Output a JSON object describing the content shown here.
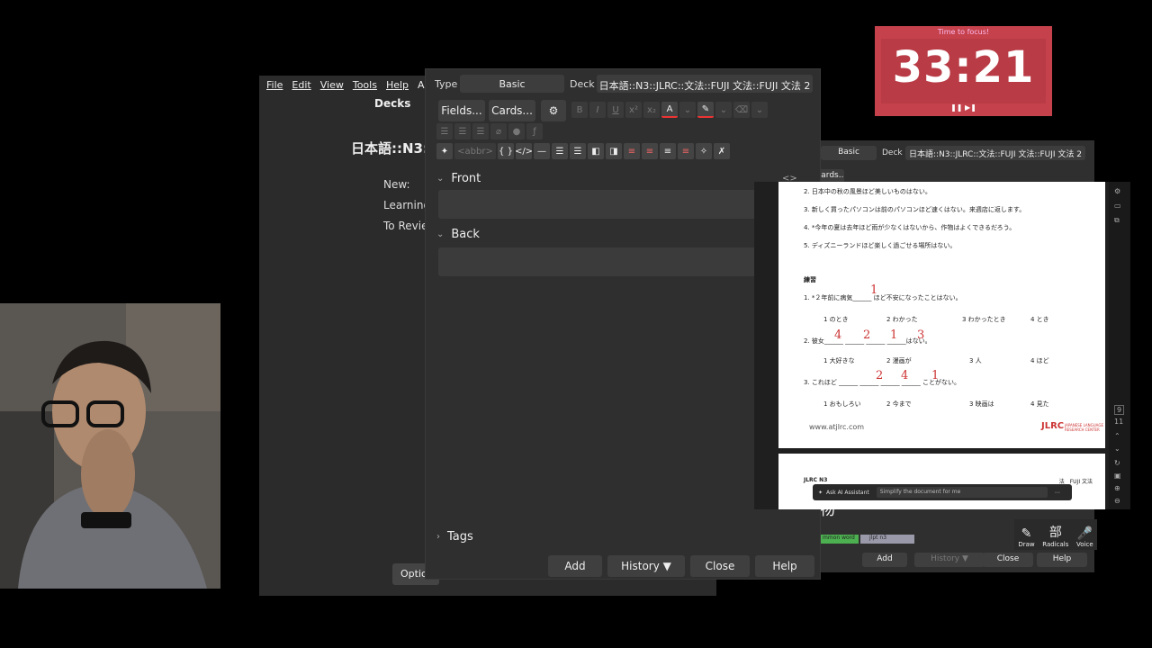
{
  "main_window": {
    "menu": [
      "File",
      "Edit",
      "View",
      "Tools",
      "Help",
      "Anki"
    ],
    "title": "Decks",
    "deck_name": "日本語::N3::",
    "stats": [
      "New:",
      "Learning",
      "To Revie"
    ],
    "options_label": "Optio"
  },
  "add_dialog": {
    "type_label": "Type",
    "type_value": "Basic",
    "deck_label": "Deck",
    "deck_value": "日本語::N3::JLRC::文法::FUJI 文法::FUJI 文法 2",
    "fields_btn": "Fields...",
    "cards_btn": "Cards...",
    "abbr_label": "<abbr>",
    "front_label": "Front",
    "back_label": "Back",
    "tags_label": "Tags",
    "add_btn": "Add",
    "history_btn": "History ▼",
    "close_btn": "Close",
    "help_btn": "Help",
    "fmt_icons": [
      "B",
      "I",
      "U",
      "x²",
      "x₂",
      "A",
      "⌫"
    ]
  },
  "add_dialog2": {
    "type_value": "Basic",
    "deck_label": "Deck",
    "deck_value": "日本語::N3::JLRC::文法::FUJI 文法::FUJI 文法 2",
    "cards_btn": "Cards...",
    "add_btn": "Add",
    "history_btn": "History ▼",
    "close_btn": "Close",
    "help_btn": "Help",
    "tag_common": "mmon word",
    "tag_jlpt": "jlpt n3",
    "kanji_partial": "物",
    "kanji_partial2": "文",
    "tools": [
      {
        "icon": "✎",
        "label": "Draw"
      },
      {
        "icon": "部",
        "label": "Radicals"
      },
      {
        "icon": "🎤",
        "label": "Voice"
      }
    ]
  },
  "pdf": {
    "lines": [
      "2.  日本中の秋の風景ほど美しいものはない。",
      "3.  新しく買ったパソコンは前のパソコンほど速くはない。来週店に返します。",
      "4.  *今年の夏は去年ほど雨が少なくはないから、作物はよくできるだろう。",
      "5.  ディズニーランドほど楽しく過ごせる場所はない。"
    ],
    "exercise_title": "練習",
    "q1": "1. *２年前に病気______ ほど不安になったことはない。",
    "q1_opts": [
      "1 のとき",
      "2 わかった",
      "3 わかったとき",
      "4 とき"
    ],
    "q2": "2. 彼女______ ______ ______ ______はない。",
    "q2_opts": [
      "1 大好きな",
      "2 漫画が",
      "3 人",
      "4 ほど"
    ],
    "q3": "3. これほど ______ ______ ______ ______ ことがない。",
    "q3_opts": [
      "1 おもしろい",
      "2 今まで",
      "3 映画は",
      "4 見た"
    ],
    "hw_q1": "1",
    "hw_q2": [
      "4",
      "2",
      "1",
      "3"
    ],
    "hw_q3": [
      "2",
      "4",
      "1"
    ],
    "footer_url": "www.atjlrc.com",
    "footer_logo": "JLRC",
    "footer_logo_sub": "JAPANESE LANGUAGE RESEARCH CENTER",
    "page2_header_left": "JLRC N3",
    "page2_header_right": "法　FUJI 文法",
    "ai_label": "Ask AI Assistant",
    "ai_placeholder": "Simplify the document for me",
    "page_size": "8.50 x 11.00 in",
    "page_num": "9",
    "page_total": "11"
  },
  "timer": {
    "caption": "Time to focus!",
    "time": "33:21",
    "controls": "❚❚ ▶❚"
  }
}
